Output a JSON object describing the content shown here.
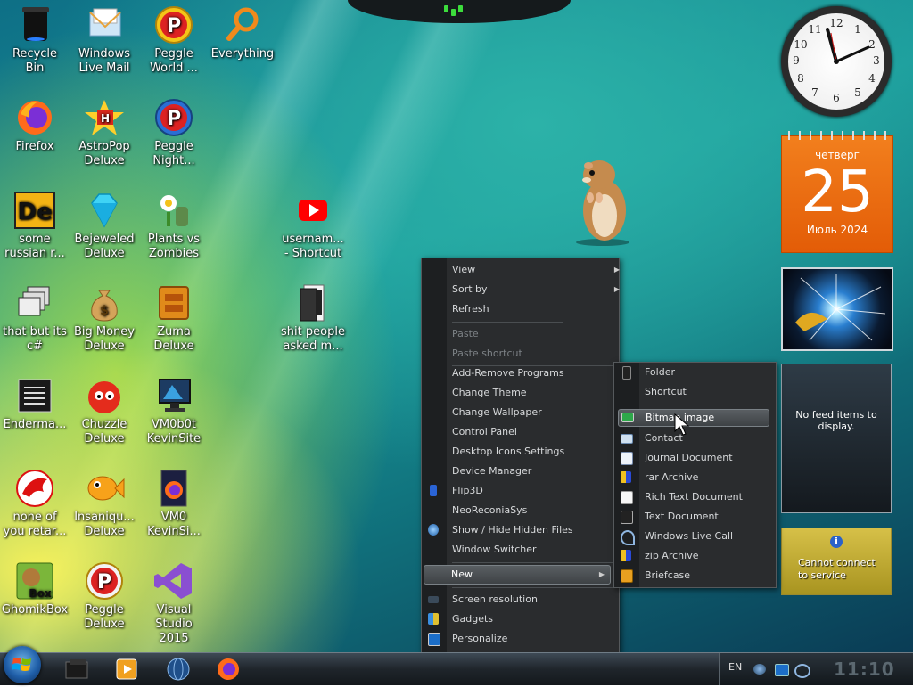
{
  "desktop_icons": [
    {
      "id": "recycle",
      "label": "Recycle\nBin",
      "icon": "recycle-bin-icon"
    },
    {
      "id": "wlmail",
      "label": "Windows\nLive Mail",
      "icon": "mail-icon"
    },
    {
      "id": "peggle-world",
      "label": "Peggle\nWorld ...",
      "icon": "peggle-icon"
    },
    {
      "id": "everything",
      "label": "Everything",
      "icon": "magnifier-icon"
    },
    {
      "id": "firefox",
      "label": "Firefox",
      "icon": "firefox-icon"
    },
    {
      "id": "astropop",
      "label": "AstroPop\nDeluxe",
      "icon": "astropop-icon"
    },
    {
      "id": "peggle-night",
      "label": "Peggle\nNight...",
      "icon": "peggle-night-icon"
    },
    {
      "id": "some-russian",
      "label": "some\nrussian r...",
      "icon": "de-icon"
    },
    {
      "id": "bejeweled",
      "label": "Bejeweled\nDeluxe",
      "icon": "gem-icon"
    },
    {
      "id": "pvz",
      "label": "Plants vs\nZombies",
      "icon": "plant-icon"
    },
    {
      "id": "username",
      "label": "usernam...\n- Shortcut",
      "icon": "youtube-icon"
    },
    {
      "id": "that-but",
      "label": "that but its\nc#",
      "icon": "windows-stack-icon"
    },
    {
      "id": "bigmoney",
      "label": "Big Money\nDeluxe",
      "icon": "money-bag-icon"
    },
    {
      "id": "zuma",
      "label": "Zuma\nDeluxe",
      "icon": "zuma-icon"
    },
    {
      "id": "shit-people",
      "label": "shit people\nasked m...",
      "icon": "folder-icon"
    },
    {
      "id": "enderman",
      "label": "Enderma...",
      "icon": "document-icon"
    },
    {
      "id": "chuzzle",
      "label": "Chuzzle\nDeluxe",
      "icon": "chuzzle-icon"
    },
    {
      "id": "vm0b0t",
      "label": "VM0b0t\nKevinSite",
      "icon": "monitor-icon"
    },
    {
      "id": "none-of",
      "label": "none of\nyou retar...",
      "icon": "dragon-icon"
    },
    {
      "id": "insaniquarium",
      "label": "Insaniqu...\nDeluxe",
      "icon": "fish-icon"
    },
    {
      "id": "vm0",
      "label": "VM0\nKevinSi...",
      "icon": "firefox-file-icon"
    },
    {
      "id": "ghomikbox",
      "label": "GhomikBox",
      "icon": "hamster-box-icon"
    },
    {
      "id": "peggle-deluxe",
      "label": "Peggle\nDeluxe",
      "icon": "peggle-icon"
    },
    {
      "id": "vs2015",
      "label": "Visual\nStudio 2015",
      "icon": "visual-studio-icon"
    }
  ],
  "gadgets": {
    "clock": {
      "numbers": [
        "12",
        "1",
        "2",
        "3",
        "4",
        "5",
        "6",
        "7",
        "8",
        "9",
        "10",
        "11"
      ]
    },
    "calendar": {
      "weekday": "четверг",
      "day": "25",
      "month_year": "Июль 2024"
    },
    "feed": {
      "text": "No feed items to display."
    },
    "weather": {
      "text_line1": "Cannot connect",
      "text_line2": "to service"
    }
  },
  "context_menu": [
    {
      "label": "View",
      "arrow": "▶",
      "disabled": false
    },
    {
      "label": "Sort by",
      "arrow": "▶",
      "disabled": false
    },
    {
      "label": "Refresh",
      "arrow": "",
      "disabled": false
    },
    {
      "label": "Paste",
      "arrow": "",
      "disabled": true
    },
    {
      "label": "Paste shortcut",
      "arrow": "",
      "disabled": true
    },
    {
      "label": "Add-Remove Programs",
      "arrow": "",
      "disabled": false
    },
    {
      "label": "Change Theme",
      "arrow": "",
      "disabled": false
    },
    {
      "label": "Change Wallpaper",
      "arrow": "",
      "disabled": false
    },
    {
      "label": "Control Panel",
      "arrow": "",
      "disabled": false
    },
    {
      "label": "Desktop Icons Settings",
      "arrow": "",
      "disabled": false
    },
    {
      "label": "Device Manager",
      "arrow": "",
      "disabled": false
    },
    {
      "label": "Flip3D",
      "arrow": "",
      "disabled": false
    },
    {
      "label": "NeoReconiaSys",
      "arrow": "",
      "disabled": false
    },
    {
      "label": "Show / Hide Hidden Files",
      "arrow": "",
      "disabled": false
    },
    {
      "label": "Window Switcher",
      "arrow": "",
      "disabled": false
    },
    {
      "label": "New",
      "arrow": "▶",
      "disabled": false
    },
    {
      "label": "Screen resolution",
      "arrow": "",
      "disabled": false
    },
    {
      "label": "Gadgets",
      "arrow": "",
      "disabled": false
    },
    {
      "label": "Personalize",
      "arrow": "",
      "disabled": false
    }
  ],
  "new_submenu": [
    {
      "label": "Folder"
    },
    {
      "label": "Shortcut"
    },
    {
      "label": "Bitmap image"
    },
    {
      "label": "Contact"
    },
    {
      "label": "Journal Document"
    },
    {
      "label": "rar Archive"
    },
    {
      "label": "Rich Text Document"
    },
    {
      "label": "Text Document"
    },
    {
      "label": "Windows Live Call"
    },
    {
      "label": "zip Archive"
    },
    {
      "label": "Briefcase"
    }
  ],
  "taskbar": {
    "pinned": [
      "explorer-icon",
      "media-player-icon",
      "globe-icon",
      "firefox-icon"
    ],
    "tray": {
      "language": "EN",
      "time": "11:10"
    }
  }
}
